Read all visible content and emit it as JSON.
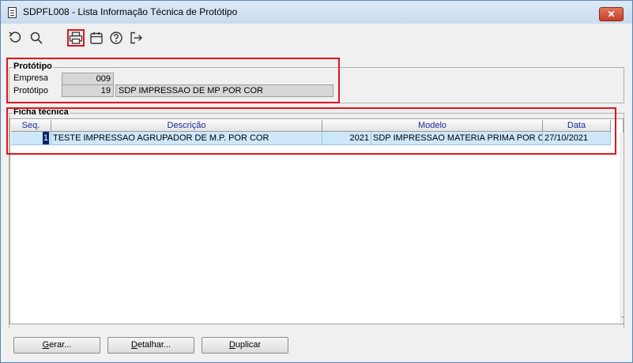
{
  "window": {
    "title": "SDPFL008 - Lista Informação Técnica de Protótipo",
    "close_label": "✕"
  },
  "toolbar": {
    "icons": [
      "undo-icon",
      "search-icon",
      "print-icon",
      "calendar-icon",
      "help-icon",
      "exit-icon"
    ]
  },
  "prototipo": {
    "legend": "Protótipo",
    "empresa_label": "Empresa",
    "empresa_value": "009",
    "prototipo_label": "Protótipo",
    "prototipo_code": "19",
    "prototipo_desc": "SDP IMPRESSAO DE MP POR COR"
  },
  "ficha": {
    "legend": "Ficha técnica",
    "columns": [
      "Seq.",
      "Descrição",
      "Modelo",
      "Data"
    ],
    "rows": [
      {
        "seq": "1",
        "descricao": "TESTE IMPRESSAO AGRUPADOR DE M.P. POR COR",
        "modelo_code": "2021",
        "modelo_desc": "SDP IMPRESSAO MATERIA PRIMA POR COR",
        "data": "27/10/2021"
      }
    ]
  },
  "buttons": {
    "gerar_u": "G",
    "gerar_rest": "erar...",
    "detalhar_u": "D",
    "detalhar_rest": "etalhar...",
    "duplicar_u": "D",
    "duplicar_rest": "uplicar"
  },
  "colors": {
    "highlight": "#e0151b",
    "selected_row": "#cde8fb",
    "header_text": "#1a2aa0"
  }
}
